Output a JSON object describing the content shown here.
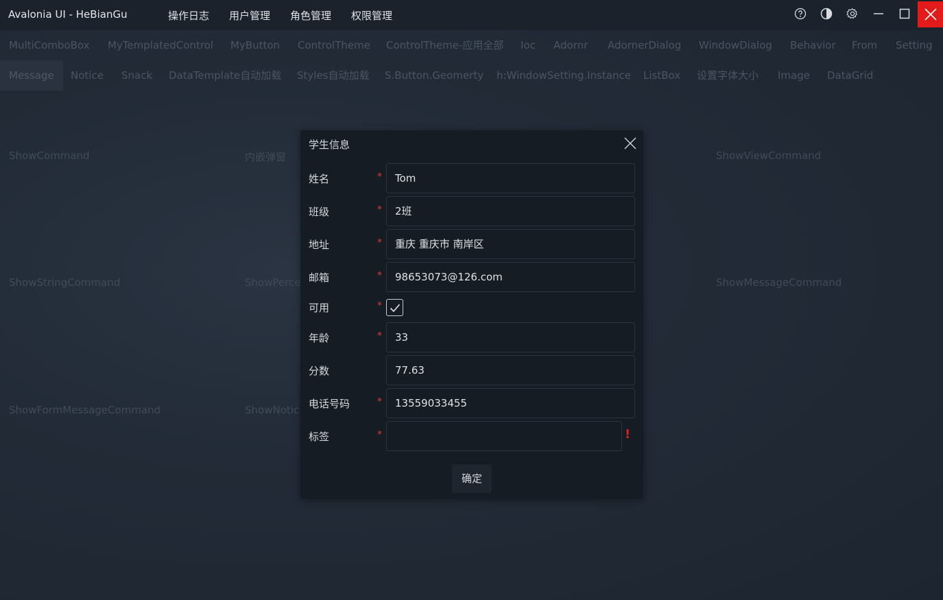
{
  "app": {
    "title": "Avalonia UI - HeBianGu"
  },
  "top_menu": [
    "操作日志",
    "用户管理",
    "角色管理",
    "权限管理"
  ],
  "window_controls": [
    "help-icon",
    "theme-icon",
    "settings-icon",
    "minimize-icon",
    "maximize-icon",
    "close-icon"
  ],
  "tabs_row1": [
    "MultiComboBox",
    "MyTemplatedControl",
    "MyButton",
    "ControlTheme",
    "ControlTheme-应用全部",
    "Ioc",
    "Adornr",
    "AdornerDialog",
    "WindowDialog",
    "Behavior",
    "From",
    "Setting"
  ],
  "tabs_row2": [
    "Message",
    "Notice",
    "Snack",
    "DataTemplate自动加载",
    "Styles自动加载",
    "S.Button.Geomerty",
    "h:WindowSetting.Instance",
    "ListBox",
    "设置字体大小",
    "Image",
    "DataGrid"
  ],
  "active_tab": "Message",
  "commands": {
    "show_command": "ShowCommand",
    "inline_dialog": "内嵌弹窗",
    "show_view_command": "ShowViewCommand",
    "show_string_command": "ShowStringCommand",
    "show_percent": "ShowPerce",
    "show_message_command": "ShowMessageCommand",
    "show_form_message_command": "ShowFormMessageCommand",
    "show_notice": "ShowNotic"
  },
  "dialog": {
    "title": "学生信息",
    "fields": {
      "name": {
        "label": "姓名",
        "required": "*",
        "value": "Tom"
      },
      "class": {
        "label": "班级",
        "required": "*",
        "value": "2班"
      },
      "address": {
        "label": "地址",
        "required": "*",
        "value": "重庆 重庆市 南岸区"
      },
      "email": {
        "label": "邮箱",
        "required": "*",
        "value": "98653073@126.com"
      },
      "enabled": {
        "label": "可用",
        "required": "*",
        "checked": true
      },
      "age": {
        "label": "年龄",
        "required": "*",
        "value": "33"
      },
      "score": {
        "label": "分数",
        "value": "77.63"
      },
      "phone": {
        "label": "电话号码",
        "required": "*",
        "value": "13559033455"
      },
      "tags": {
        "label": "标签",
        "required": "*",
        "value": "",
        "error": "!"
      }
    },
    "confirm_label": "确定"
  },
  "colors": {
    "close_button": "#e21a1a",
    "required_mark": "#d83a3a",
    "error_mark": "#e02020"
  }
}
